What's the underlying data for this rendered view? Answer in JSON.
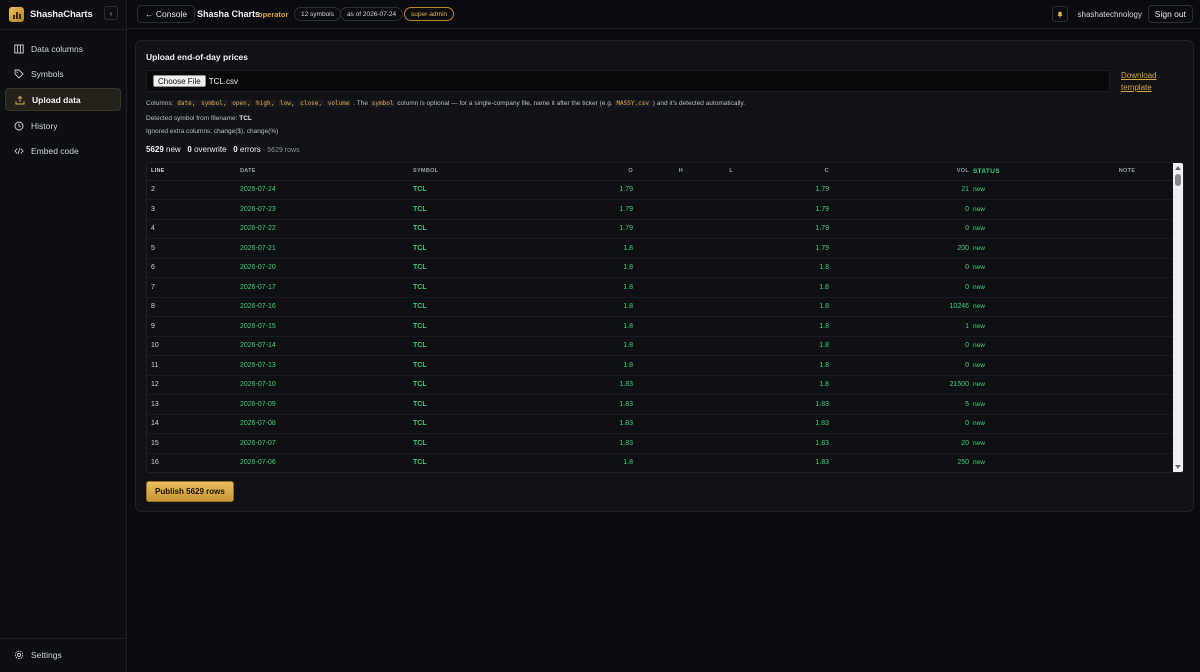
{
  "app": {
    "brand_name": "ShashaCharts",
    "collapse_glyph": "‹"
  },
  "sidebar": {
    "items": [
      {
        "label": "Data columns",
        "icon": "columns-icon"
      },
      {
        "label": "Symbols",
        "icon": "tag-icon"
      },
      {
        "label": "Upload data",
        "icon": "upload-icon",
        "active": true
      },
      {
        "label": "History",
        "icon": "clock-icon"
      },
      {
        "label": "Embed code",
        "icon": "code-icon"
      }
    ],
    "settings_label": "Settings"
  },
  "topbar": {
    "console_label": "← Console",
    "title": "Shasha Charts",
    "role": "operator",
    "symbols_pill": "12 symbols",
    "date_pill": "as of 2026-07-24",
    "admin_pill": "super-admin",
    "user_name": "shashatechnology",
    "signout_label": "Sign out"
  },
  "upload": {
    "title": "Upload end-of-day prices",
    "choose_file_label": "Choose File",
    "file_name": "TCL.csv",
    "download_label_line1": "Download",
    "download_label_line2": "template",
    "columns_prefix": "Columns:",
    "columns": [
      "date,",
      "symbol,",
      "open,",
      "high,",
      "low,",
      "close,",
      "volume"
    ],
    "columns_mid": ". The",
    "symbol_code": "symbol",
    "columns_suffix": "column is optional — for a single-company file, name it after the ticker (e.g.",
    "example_code": "MASSY.csv",
    "columns_end": ") and it's detected automatically.",
    "detected_label": "Detected symbol from filename:",
    "detected_value": "TCL",
    "ignored_text": "Ignored extra columns: change($), change(%)",
    "stats": {
      "new_count": "5629",
      "new_label": "new",
      "overwrite_count": "0",
      "overwrite_label": "overwrite",
      "errors_count": "0",
      "errors_label": "errors",
      "rows_text": "· 5629 rows"
    },
    "publish_label": "Publish 5629 rows"
  },
  "table": {
    "headers": [
      "LINE",
      "DATE",
      "SYMBOL",
      "O",
      "H",
      "L",
      "C",
      "VOL",
      "STATUS",
      "NOTE"
    ],
    "rows": [
      [
        "2",
        "2026-07-24",
        "TCL",
        "1.79",
        "",
        "",
        "1.79",
        "21",
        "new",
        ""
      ],
      [
        "3",
        "2026-07-23",
        "TCL",
        "1.79",
        "",
        "",
        "1.79",
        "0",
        "new",
        ""
      ],
      [
        "4",
        "2026-07-22",
        "TCL",
        "1.79",
        "",
        "",
        "1.79",
        "0",
        "new",
        ""
      ],
      [
        "5",
        "2026-07-21",
        "TCL",
        "1.8",
        "",
        "",
        "1.79",
        "200",
        "new",
        ""
      ],
      [
        "6",
        "2026-07-20",
        "TCL",
        "1.8",
        "",
        "",
        "1.8",
        "0",
        "new",
        ""
      ],
      [
        "7",
        "2026-07-17",
        "TCL",
        "1.8",
        "",
        "",
        "1.8",
        "0",
        "new",
        ""
      ],
      [
        "8",
        "2026-07-16",
        "TCL",
        "1.8",
        "",
        "",
        "1.8",
        "10246",
        "new",
        ""
      ],
      [
        "9",
        "2026-07-15",
        "TCL",
        "1.8",
        "",
        "",
        "1.8",
        "1",
        "new",
        ""
      ],
      [
        "10",
        "2026-07-14",
        "TCL",
        "1.8",
        "",
        "",
        "1.8",
        "0",
        "new",
        ""
      ],
      [
        "11",
        "2026-07-13",
        "TCL",
        "1.8",
        "",
        "",
        "1.8",
        "0",
        "new",
        ""
      ],
      [
        "12",
        "2026-07-10",
        "TCL",
        "1.83",
        "",
        "",
        "1.8",
        "21500",
        "new",
        ""
      ],
      [
        "13",
        "2026-07-09",
        "TCL",
        "1.83",
        "",
        "",
        "1.83",
        "5",
        "new",
        ""
      ],
      [
        "14",
        "2026-07-08",
        "TCL",
        "1.83",
        "",
        "",
        "1.83",
        "0",
        "new",
        ""
      ],
      [
        "15",
        "2026-07-07",
        "TCL",
        "1.83",
        "",
        "",
        "1.83",
        "20",
        "new",
        ""
      ],
      [
        "16",
        "2026-07-06",
        "TCL",
        "1.8",
        "",
        "",
        "1.83",
        "250",
        "new",
        ""
      ]
    ]
  }
}
